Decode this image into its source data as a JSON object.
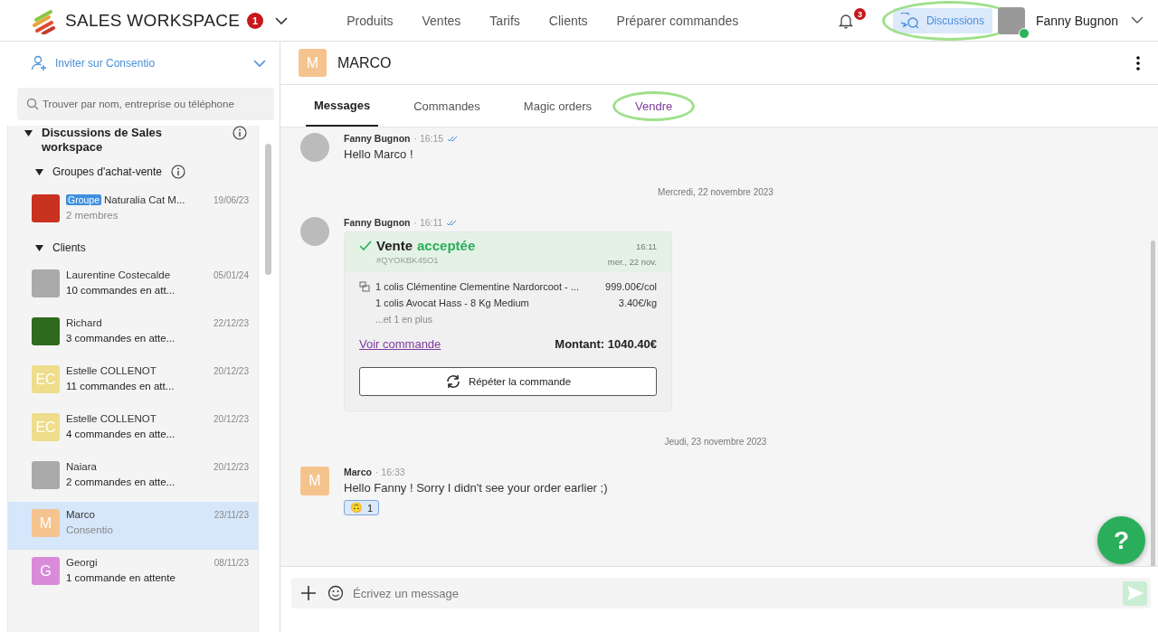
{
  "topbar": {
    "workspace": "SALES WORKSPACE",
    "workspace_badge": "1",
    "nav": [
      {
        "label": "Produits"
      },
      {
        "label": "Ventes"
      },
      {
        "label": "Tarifs"
      },
      {
        "label": "Clients"
      },
      {
        "label": "Préparer commandes"
      }
    ],
    "notifications_badge": "3",
    "discussions": {
      "label": "Discussions",
      "selected": true,
      "highlighted": true
    },
    "user": {
      "name": "Fanny Bugnon",
      "online": true
    }
  },
  "sidebar": {
    "invite": "Inviter sur Consentio",
    "search": {
      "placeholder": "Trouver par nom, entreprise ou téléphone"
    },
    "section": {
      "title": "Discussions de Sales workspace",
      "expanded": true,
      "groups": [
        {
          "title": "Groupes d'achat-vente",
          "expanded": true,
          "info": true,
          "items": [
            {
              "kind": "group",
              "color": "#c8321e",
              "tag": "Groupe",
              "name": "Naturalia Cat M...",
              "date": "19/06/23",
              "subtitle": "2 membres",
              "selected": false
            }
          ]
        },
        {
          "title": "Clients",
          "expanded": true,
          "info": false,
          "items": [
            {
              "kind": "contact",
              "name": "Laurentine Costecalde",
              "date": "05/01/24",
              "subtitle": "10 commandes en att...",
              "selected": false
            },
            {
              "kind": "contact",
              "color": "#2e6b1f",
              "name": "Richard",
              "date": "22/12/23",
              "subtitle": "3 commandes en atte...",
              "selected": false
            },
            {
              "kind": "contact",
              "initials": "EC",
              "color": "#eedd8a",
              "name": "Estelle COLLENOT",
              "date": "20/12/23",
              "subtitle": "11 commandes en att...",
              "selected": false
            },
            {
              "kind": "contact",
              "initials": "EC",
              "color": "#eedd8a",
              "name": "Estelle COLLENOT",
              "date": "20/12/23",
              "subtitle": "4 commandes en atte...",
              "selected": false
            },
            {
              "kind": "contact",
              "name": "Naiara",
              "date": "20/12/23",
              "subtitle": "2 commandes en atte...",
              "selected": false
            },
            {
              "kind": "contact",
              "initials": "M",
              "color": "#f5c48e",
              "name": "Marco",
              "date": "23/11/23",
              "subtitle": "Consentio",
              "selected": true
            },
            {
              "kind": "contact",
              "initials": "G",
              "color": "#d98bd9",
              "name": "Georgi",
              "date": "08/11/23",
              "subtitle": "1 commande en attente",
              "selected": false
            }
          ]
        }
      ]
    }
  },
  "chat": {
    "initials": "M",
    "color": "#f5c48e",
    "title": "MARCO",
    "tabs": [
      {
        "label": "Messages",
        "selected": true,
        "highlighted": false
      },
      {
        "label": "Commandes",
        "selected": false,
        "highlighted": false
      },
      {
        "label": "Magic orders",
        "selected": false,
        "highlighted": false
      },
      {
        "label": "Vendre",
        "selected": false,
        "highlighted": true
      }
    ],
    "messages": [
      {
        "kind": "text",
        "author": "Fanny Bugnon",
        "time": "· 16:15",
        "read": true,
        "text": "Hello Marco !"
      },
      {
        "kind": "date",
        "text": "Mercredi, 22 novembre 2023"
      },
      {
        "kind": "sale",
        "author": "Fanny Bugnon",
        "time": "· 16:11",
        "read": true,
        "title": "Vente",
        "status": "acceptée",
        "ref": "#QYOKBK45O1",
        "card_time": "16:11",
        "card_date": "mer., 22 nov.",
        "lines": [
          {
            "text": "1 colis Clémentine Clementine Nardorcoot - ...",
            "price": "999.00€/col"
          },
          {
            "text": "1 colis Avocat Hass - 8 Kg Medium",
            "price": "3.40€/kg"
          }
        ],
        "more": "...et 1 en plus",
        "link": "Voir commande",
        "amount_label": "Montant:",
        "amount": "1040.40€",
        "button": "Répéter la commande"
      },
      {
        "kind": "date",
        "text": "Jeudi, 23 novembre 2023"
      },
      {
        "kind": "text",
        "author": "Marco",
        "initials": "M",
        "color": "#f5c48e",
        "time": "· 16:33",
        "read": false,
        "text": "Hello Fanny ! Sorry I didn't see your order earlier ;)",
        "reaction": {
          "emoji": "🙃",
          "count": "1"
        }
      }
    ],
    "composer": {
      "placeholder": "Écrivez un message"
    },
    "help": "?"
  }
}
